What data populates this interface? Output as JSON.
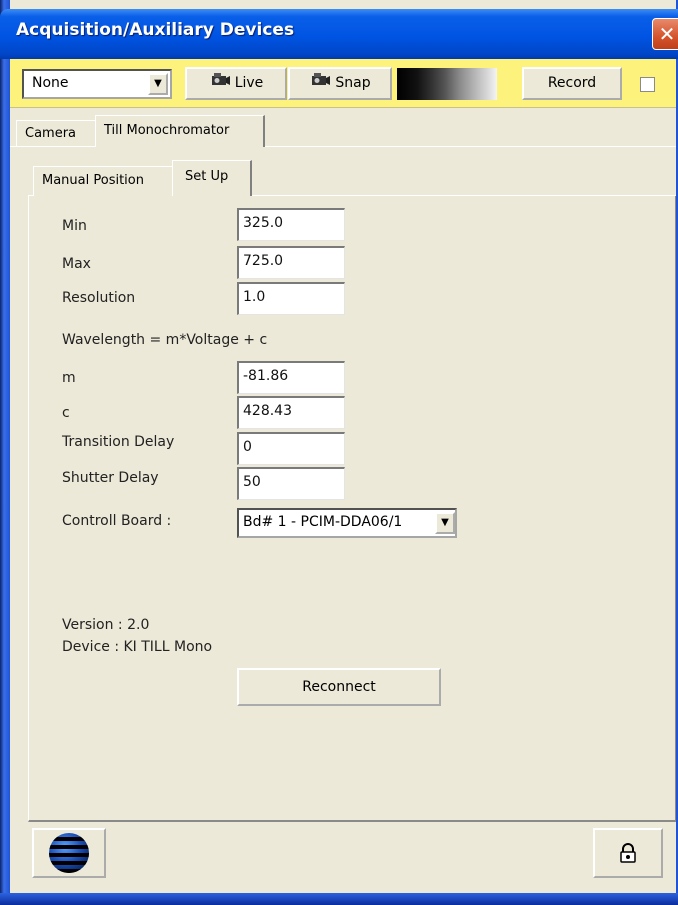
{
  "window": {
    "title": "Acquisition/Auxiliary Devices",
    "close_symbol": "✕"
  },
  "toolbar": {
    "camera_select_value": "None",
    "live_label": "Live",
    "snap_label": "Snap",
    "record_label": "Record",
    "record_checked": false,
    "live_icon": "camera-icon",
    "snap_icon": "camera-icon"
  },
  "outer_tabs": [
    {
      "label": "Camera",
      "active": false
    },
    {
      "label": "Till Monochromator",
      "active": true
    }
  ],
  "inner_tabs": [
    {
      "label": "Manual Position",
      "active": false
    },
    {
      "label": "Set Up",
      "active": true
    }
  ],
  "setup": {
    "min_label": "Min",
    "min_value": "325.0",
    "max_label": "Max",
    "max_value": "725.0",
    "resolution_label": "Resolution",
    "resolution_value": "1.0",
    "formula": "Wavelength = m*Voltage + c",
    "m_label": "m",
    "m_value": "-81.86",
    "c_label": "c",
    "c_value": "428.43",
    "transition_delay_label": "Transition Delay",
    "transition_delay_value": "0",
    "shutter_delay_label": "Shutter Delay",
    "shutter_delay_value": "50",
    "control_board_label": "Controll Board :",
    "control_board_value": "Bd# 1 - PCIM-DDA06/1",
    "version_text": "Version : 2.0",
    "device_text": "Device : KI TILL Mono",
    "reconnect_label": "Reconnect"
  },
  "bottom": {
    "logo_icon": "globe-logo-icon",
    "lock_icon": "padlock-icon"
  },
  "colors": {
    "title_bar": "#0054e3",
    "toolbar_bg": "#fdf37c",
    "dialog_bg": "#ece9d8",
    "close_button": "#d4532c"
  }
}
